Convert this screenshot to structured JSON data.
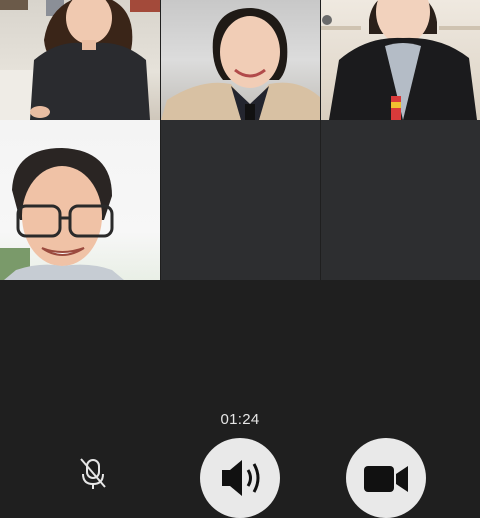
{
  "call": {
    "duration": "01:24"
  },
  "participants": [
    {
      "video": "on"
    },
    {
      "video": "on"
    },
    {
      "video": "on"
    },
    {
      "video": "on"
    },
    {
      "video": "off"
    },
    {
      "video": "off"
    }
  ],
  "controls": [
    {
      "icon": "mic-muted-icon"
    },
    {
      "icon": "speaker-icon"
    },
    {
      "icon": "camera-icon"
    }
  ],
  "colors": {
    "background": "#1f1f1f",
    "empty_tile": "#2d2e30",
    "control_button": "#e9e9e9",
    "timer_text": "#e6e6e6"
  }
}
